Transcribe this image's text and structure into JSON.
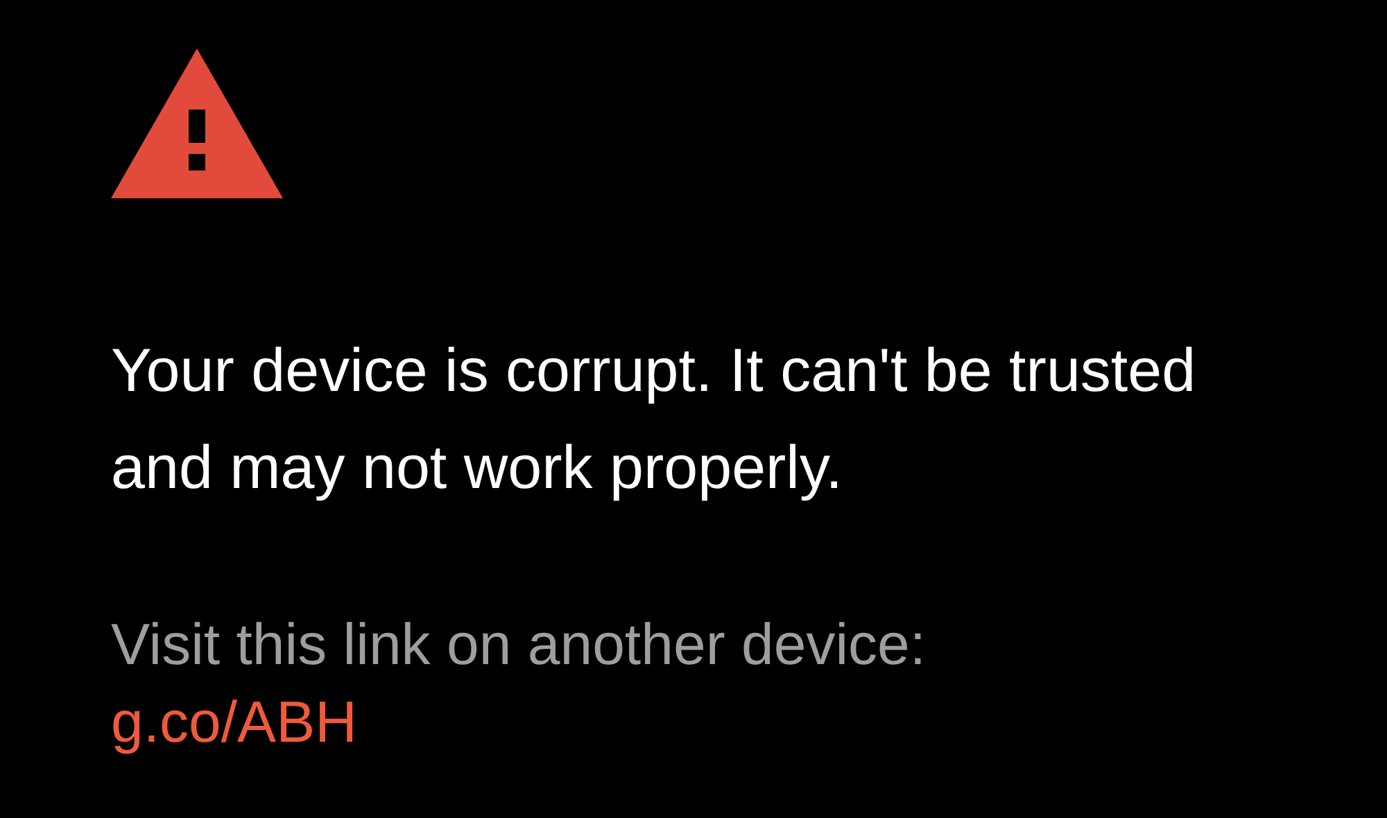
{
  "warning": {
    "message": "Your device is corrupt. It can't be trusted and may not work properly.",
    "instruction": "Visit this link on another device:",
    "link": "g.co/ABH"
  }
}
